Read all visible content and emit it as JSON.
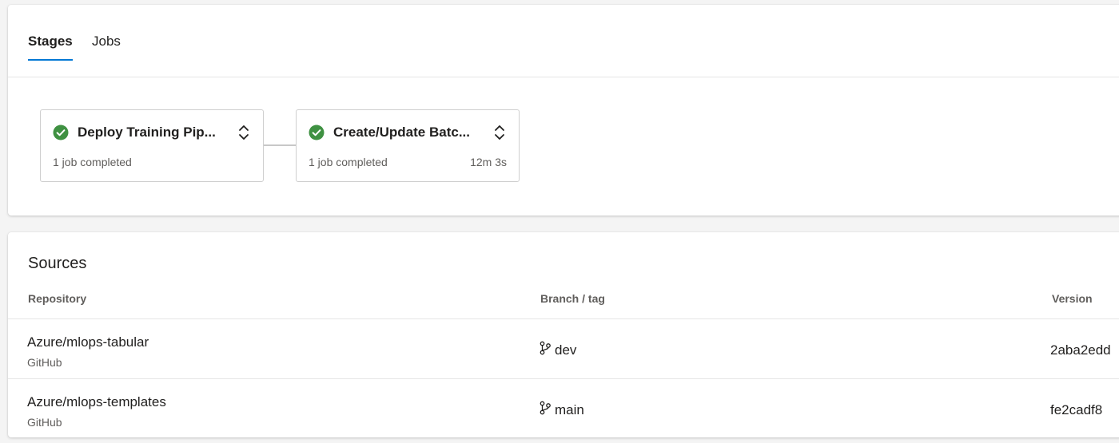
{
  "tabs": [
    {
      "label": "Stages",
      "active": true
    },
    {
      "label": "Jobs",
      "active": false
    }
  ],
  "stages": [
    {
      "name": "Deploy Training Pip...",
      "status": "1 job completed",
      "duration": "",
      "status_icon": "check-circle-icon"
    },
    {
      "name": "Create/Update Batc...",
      "status": "1 job completed",
      "duration": "12m 3s",
      "status_icon": "check-circle-icon"
    }
  ],
  "sources": {
    "title": "Sources",
    "columns": {
      "repository": "Repository",
      "branch": "Branch / tag",
      "version": "Version"
    },
    "rows": [
      {
        "repository": "Azure/mlops-tabular",
        "provider": "GitHub",
        "branch": "dev",
        "version": "2aba2edd"
      },
      {
        "repository": "Azure/mlops-templates",
        "provider": "GitHub",
        "branch": "main",
        "version": "fe2cadf8"
      }
    ]
  },
  "colors": {
    "accent": "#0078d4",
    "success": "#3f9142",
    "muted_text": "#605e5c"
  }
}
